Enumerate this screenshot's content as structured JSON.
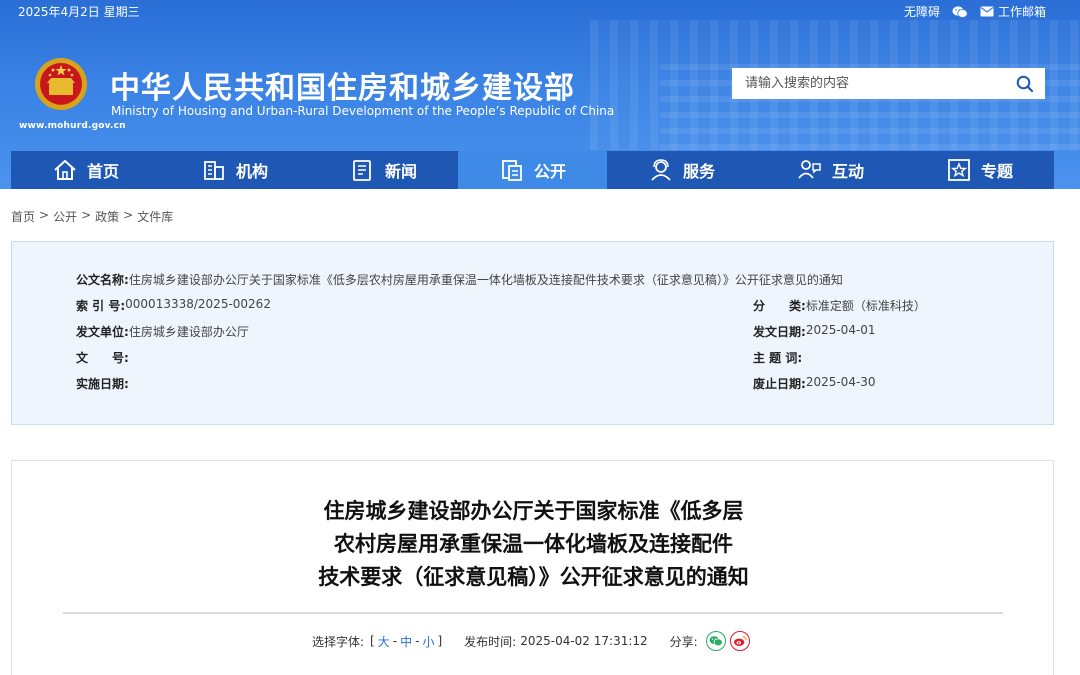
{
  "topbar": {
    "date": "2025年4月2日 星期三",
    "accessibility": "无障碍",
    "wechat_icon": "wechat-icon",
    "mail": "工作邮箱"
  },
  "header": {
    "title": "中华人民共和国住房和城乡建设部",
    "subtitle": "Ministry of Housing and Urban-Rural Development of the People’s Republic of China",
    "url": "www.mohurd.gov.cn",
    "search_placeholder": "请输入搜索的内容"
  },
  "nav": {
    "items": [
      {
        "label": "首页",
        "icon": "home-icon"
      },
      {
        "label": "机构",
        "icon": "building-icon"
      },
      {
        "label": "新闻",
        "icon": "news-icon"
      },
      {
        "label": "公开",
        "icon": "document-icon",
        "active": true
      },
      {
        "label": "服务",
        "icon": "service-icon"
      },
      {
        "label": "互动",
        "icon": "interaction-icon"
      },
      {
        "label": "专题",
        "icon": "star-icon"
      }
    ]
  },
  "breadcrumb": {
    "items": [
      "首页",
      "公开",
      "政策",
      "文件库"
    ],
    "sep": ">"
  },
  "meta": {
    "title_k": "公文名称:",
    "title_v": "住房城乡建设部办公厅关于国家标准《低多层农村房屋用承重保温一体化墙板及连接配件技术要求（征求意见稿）》公开征求意见的通知",
    "index_k": "索 引 号:",
    "index_v": "000013338/2025-00262",
    "category_k": "分　　类:",
    "category_v": "标准定额（标准科技）",
    "issuer_k": "发文单位:",
    "issuer_v": "住房城乡建设部办公厅",
    "date_k": "发文日期:",
    "date_v": "2025-04-01",
    "docno_k": "文　　号:",
    "docno_v": "",
    "subject_k": "主 题 词:",
    "subject_v": "",
    "effective_k": "实施日期:",
    "effective_v": "",
    "expire_k": "废止日期:",
    "expire_v": "2025-04-30"
  },
  "article": {
    "title_lines": [
      "住房城乡建设部办公厅关于国家标准《低多层",
      "农村房屋用承重保温一体化墙板及连接配件",
      "技术要求（征求意见稿）》公开征求意见的通知"
    ],
    "font_label": "选择字体:",
    "font_open": "[",
    "font_large": "大",
    "font_medium": "中",
    "font_small": "小",
    "font_dash": "-",
    "font_close": "]",
    "publish_label": "发布时间:",
    "publish_time": "2025-04-02 17:31:12",
    "share_label": "分享:"
  },
  "colors": {
    "header_blue": "#3a82e4",
    "nav_blue": "#1f57b4",
    "nav_active": "#3f8ae6",
    "meta_bg": "#eef5fc",
    "link_blue": "#2a6ed6",
    "wechat_green": "#2aae67",
    "weibo_red": "#e6162d"
  }
}
